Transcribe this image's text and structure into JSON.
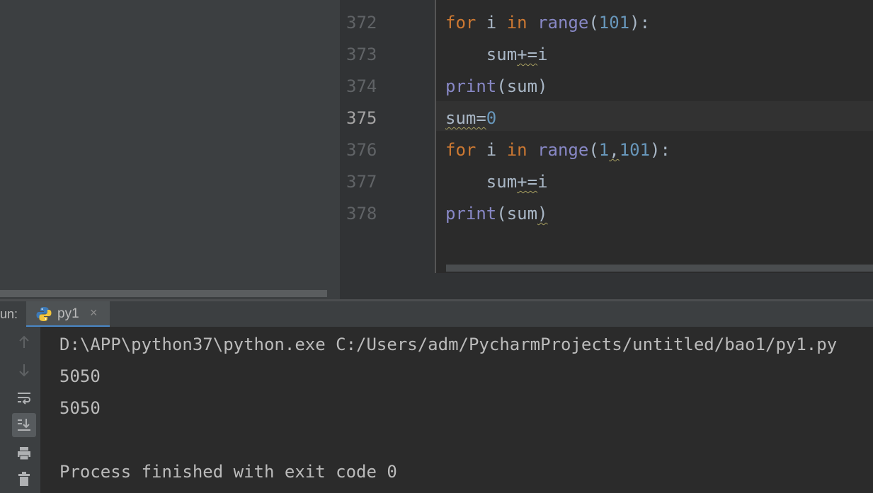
{
  "editor": {
    "lines": [
      {
        "num": "372",
        "tokens": [
          {
            "t": "for",
            "c": "kw"
          },
          {
            "t": " i ",
            "c": ""
          },
          {
            "t": "in",
            "c": "kw"
          },
          {
            "t": " ",
            "c": ""
          },
          {
            "t": "range",
            "c": "fn"
          },
          {
            "t": "(",
            "c": ""
          },
          {
            "t": "101",
            "c": "num"
          },
          {
            "t": "):",
            "c": ""
          }
        ]
      },
      {
        "num": "373",
        "tokens": [
          {
            "t": "    sum",
            "c": ""
          },
          {
            "t": "+=",
            "c": "warn"
          },
          {
            "t": "i",
            "c": ""
          }
        ]
      },
      {
        "num": "374",
        "tokens": [
          {
            "t": "print",
            "c": "fn"
          },
          {
            "t": "(sum)",
            "c": ""
          }
        ]
      },
      {
        "num": "375",
        "tokens": [
          {
            "t": "sum=",
            "c": "warn"
          },
          {
            "t": "0",
            "c": "num"
          }
        ]
      },
      {
        "num": "376",
        "tokens": [
          {
            "t": "for",
            "c": "kw"
          },
          {
            "t": " i ",
            "c": ""
          },
          {
            "t": "in",
            "c": "kw"
          },
          {
            "t": " ",
            "c": ""
          },
          {
            "t": "range",
            "c": "fn"
          },
          {
            "t": "(",
            "c": ""
          },
          {
            "t": "1",
            "c": "num"
          },
          {
            "t": ",",
            "c": "warn"
          },
          {
            "t": "101",
            "c": "num"
          },
          {
            "t": "):",
            "c": ""
          }
        ]
      },
      {
        "num": "377",
        "tokens": [
          {
            "t": "    sum",
            "c": ""
          },
          {
            "t": "+=",
            "c": "warn"
          },
          {
            "t": "i",
            "c": ""
          }
        ]
      },
      {
        "num": "378",
        "tokens": [
          {
            "t": "print",
            "c": "fn"
          },
          {
            "t": "(sum",
            "c": ""
          },
          {
            "t": ")",
            "c": "warn"
          }
        ]
      }
    ],
    "active_line": "375"
  },
  "run": {
    "label": "un:",
    "tab_label": "py1",
    "tab_close": "×",
    "output": [
      "D:\\APP\\python37\\python.exe C:/Users/adm/PycharmProjects/untitled/bao1/py1.py",
      "5050",
      "5050",
      "",
      "Process finished with exit code 0"
    ]
  },
  "icons": {
    "toolbar": [
      "arrow-up-icon",
      "arrow-down-icon",
      "soft-wrap-icon",
      "scroll-to-end-icon",
      "print-icon",
      "trash-icon"
    ],
    "tab": "python-icon"
  },
  "colors": {
    "keyword": "#cc7832",
    "builtin": "#8888c6",
    "number": "#6897bb",
    "text": "#a9b7c6",
    "accent": "#4a88c7"
  }
}
